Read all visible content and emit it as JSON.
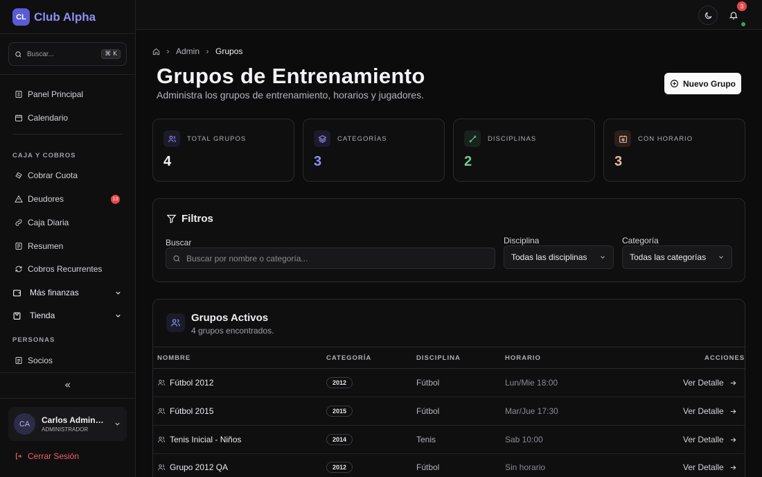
{
  "brand": {
    "logo": "CL",
    "name": "Club Alpha"
  },
  "search": {
    "placeholder": "Buscar...",
    "shortcut": "⌘ K"
  },
  "nav": {
    "main": [
      {
        "label": "Panel Principal",
        "icon": "layout-grid-icon"
      },
      {
        "label": "Calendario",
        "icon": "calendar-icon"
      }
    ],
    "caja_title": "CAJA Y COBROS",
    "caja": [
      {
        "label": "Cobrar Cuota",
        "icon": "credit-card-icon"
      },
      {
        "label": "Deudores",
        "icon": "alert-triangle-icon",
        "badge": "13"
      },
      {
        "label": "Caja Diaria",
        "icon": "link-icon"
      },
      {
        "label": "Resumen",
        "icon": "receipt-icon"
      },
      {
        "label": "Cobros Recurrentes",
        "icon": "refresh-icon"
      }
    ],
    "groups": [
      {
        "label": "Más finanzas",
        "icon": "wallet-icon"
      },
      {
        "label": "Tienda",
        "icon": "store-icon"
      }
    ],
    "personas_title": "PERSONAS",
    "personas": [
      {
        "label": "Socios",
        "icon": "id-card-icon"
      }
    ]
  },
  "user": {
    "initials": "CA",
    "name": "Carlos Administrador",
    "role": "ADMINISTRADOR"
  },
  "logout_label": "Cerrar Sesión",
  "topbar": {
    "notifications": "3"
  },
  "breadcrumb": {
    "admin": "Admin",
    "current": "Grupos"
  },
  "page": {
    "title": "Grupos de Entrenamiento",
    "subtitle": "Administra los grupos de entrenamiento, horarios y jugadores.",
    "new_button": "Nuevo Grupo"
  },
  "stats": [
    {
      "label": "TOTAL GRUPOS",
      "value": "4",
      "color": "#f4f4f6",
      "accent": "#5b5bd6"
    },
    {
      "label": "CATEGORÍAS",
      "value": "3",
      "color": "#8f8ff3",
      "accent": "#5b5bd6"
    },
    {
      "label": "DISCIPLINAS",
      "value": "2",
      "color": "#7bc79a",
      "accent": "#30a46c"
    },
    {
      "label": "CON HORARIO",
      "value": "3",
      "color": "#eab9a0",
      "accent": "#e4a47c"
    }
  ],
  "filters": {
    "title": "Filtros",
    "search_label": "Buscar",
    "search_placeholder": "Buscar por nombre o categoría...",
    "disciplina_label": "Disciplina",
    "disciplina_value": "Todas las disciplinas",
    "categoria_label": "Categoría",
    "categoria_value": "Todas las categorías"
  },
  "groups": {
    "title": "Grupos Activos",
    "subtitle": "4 grupos encontrados.",
    "columns": {
      "nombre": "NOMBRE",
      "categoria": "CATEGORÍA",
      "disciplina": "DISCIPLINA",
      "horario": "HORARIO",
      "acciones": "ACCIONES"
    },
    "action_label": "Ver Detalle",
    "rows": [
      {
        "nombre": "Fútbol 2012",
        "categoria": "2012",
        "disciplina": "Fútbol",
        "horario": "Lun/Mie 18:00"
      },
      {
        "nombre": "Fútbol 2015",
        "categoria": "2015",
        "disciplina": "Fútbol",
        "horario": "Mar/Jue 17:30"
      },
      {
        "nombre": "Tenis Inicial - Niños",
        "categoria": "2014",
        "disciplina": "Tenis",
        "horario": "Sab 10:00"
      },
      {
        "nombre": "Grupo 2012 QA",
        "categoria": "2012",
        "disciplina": "Fútbol",
        "horario": "Sin horario"
      }
    ]
  }
}
